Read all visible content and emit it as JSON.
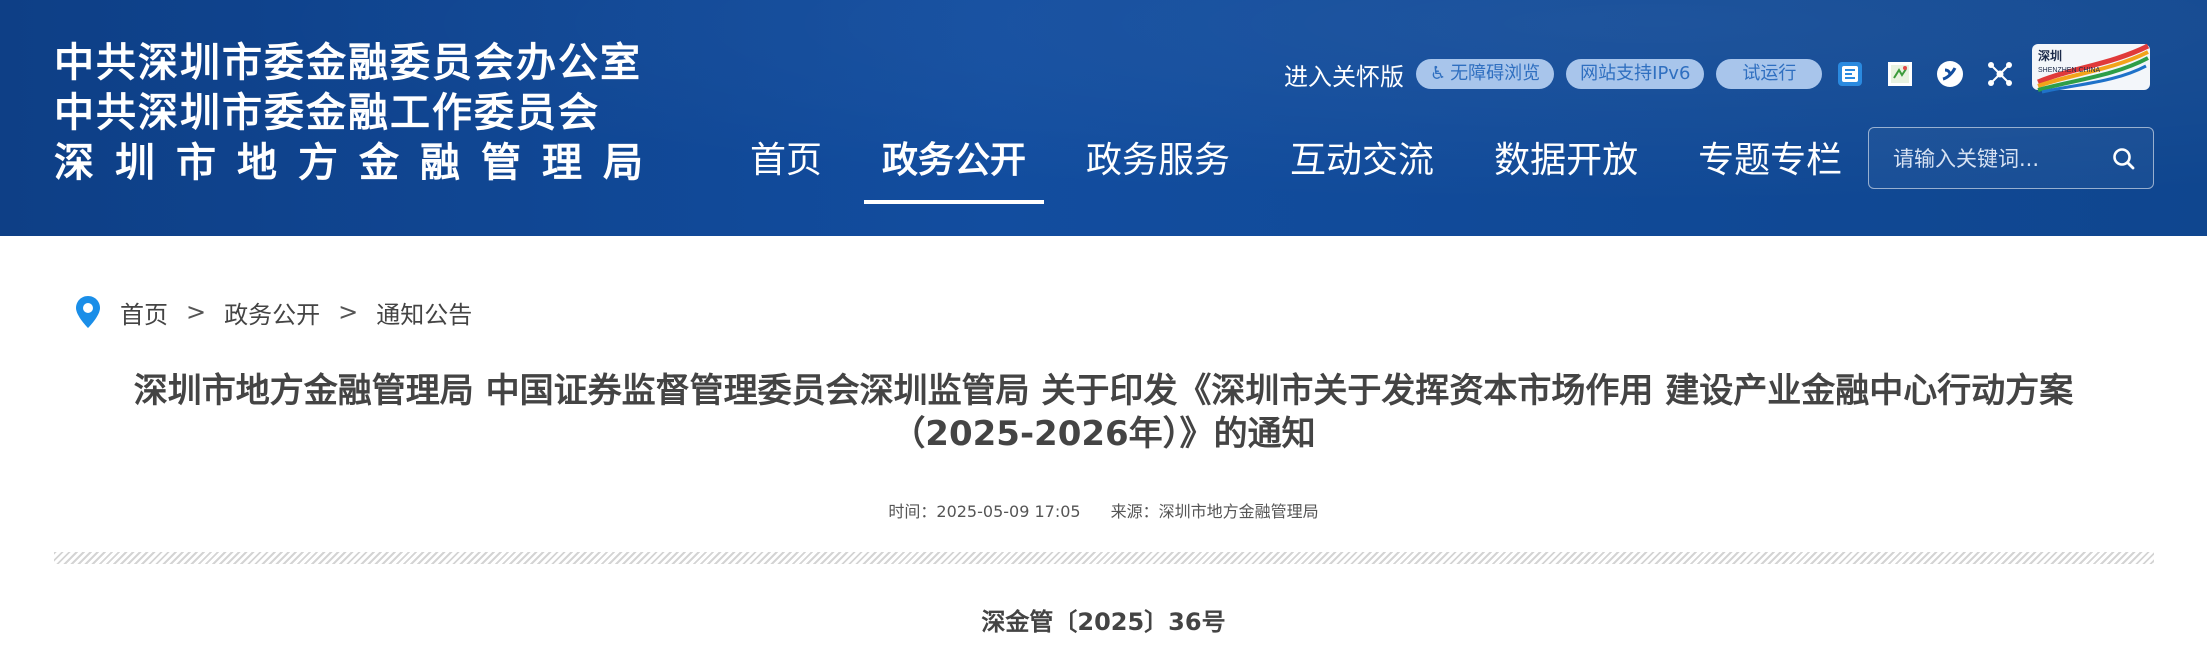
{
  "header": {
    "org_lines": [
      "中共深圳市委金融委员会办公室",
      "中共深圳市委金融工作委员会",
      "深圳市地方金融管理局"
    ],
    "care_mode": "进入关怀版",
    "accessibility": "无障碍浏览",
    "ipv6": "网站支持IPv6",
    "trial": "试运行",
    "logo_text": "SHENZHEN CHINA"
  },
  "nav": {
    "items": [
      "首页",
      "政务公开",
      "政务服务",
      "互动交流",
      "数据开放",
      "专题专栏"
    ],
    "active_index": 1
  },
  "search": {
    "placeholder": "请输入关键词..."
  },
  "breadcrumb": [
    "首页",
    "政务公开",
    "通知公告"
  ],
  "breadcrumb_sep": ">",
  "article": {
    "title_line1": "深圳市地方金融管理局 中国证券监督管理委员会深圳监管局 关于印发《深圳市关于发挥资本市场作用 建设产业金融中心行动方案",
    "title_line2": "（2025-2026年）》的通知",
    "time": "时间：2025-05-09 17:05",
    "source": "来源：深圳市地方金融管理局",
    "doc_number": "深金管〔2025〕36号"
  },
  "colors": {
    "header_bg": "#124d9f",
    "pill_bg": "#a8c5eb",
    "pill_text": "#2f6fc0",
    "text": "#444444"
  }
}
